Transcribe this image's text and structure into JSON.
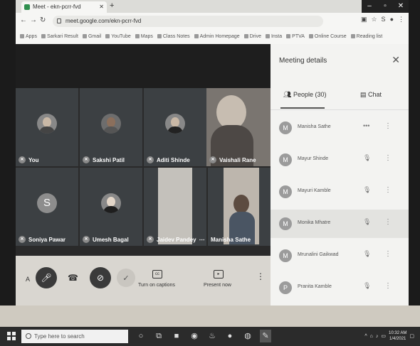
{
  "browser": {
    "tab_title": "Meet - ekn-pcrr-fvd",
    "url": "meet.google.com/ekn-pcrr-fvd",
    "bookmarks": [
      "Apps",
      "Sarkari Result",
      "Gmail",
      "YouTube",
      "Maps",
      "Class Notes",
      "Admin Homepage",
      "Drive",
      "Insta",
      "PTVA",
      "Online Course",
      "Reading list"
    ]
  },
  "tiles": [
    {
      "name": "You",
      "kind": "avatar"
    },
    {
      "name": "Sakshi Patil",
      "kind": "avatar"
    },
    {
      "name": "Aditi Shinde",
      "kind": "avatar"
    },
    {
      "name": "Vaishali Rane",
      "kind": "video"
    },
    {
      "name": "Soniya Pawar",
      "kind": "letter",
      "letter": "S"
    },
    {
      "name": "Umesh Bagal",
      "kind": "avatar"
    },
    {
      "name": "Jaidev Pandey",
      "kind": "video"
    },
    {
      "name": "Manisha Sathe",
      "kind": "video"
    }
  ],
  "controls": {
    "captions_label": "Turn on captions",
    "present_label": "Present now"
  },
  "panel": {
    "title": "Meeting details",
    "people_tab": "People (30)",
    "chat_tab": "Chat",
    "participants": [
      {
        "name": "Manisha Sathe",
        "initial": "M"
      },
      {
        "name": "Mayur Shinde",
        "initial": "M"
      },
      {
        "name": "Mayuri Kamble",
        "initial": "M"
      },
      {
        "name": "Monika Mhatre",
        "initial": "M"
      },
      {
        "name": "Mrunalini Gaikwad",
        "initial": "M"
      },
      {
        "name": "Pranita Kamble",
        "initial": "P"
      }
    ]
  },
  "taskbar": {
    "search_placeholder": "Type here to search",
    "time": "10:32 AM",
    "date": "1/4/2021"
  }
}
